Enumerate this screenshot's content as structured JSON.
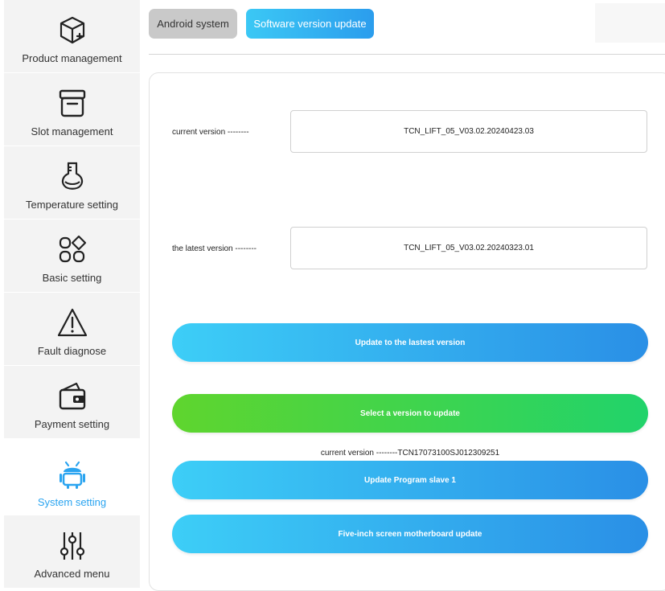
{
  "sidebar": {
    "items": [
      {
        "label": "Product management",
        "icon": "box-plus-icon",
        "active": false
      },
      {
        "label": "Slot management",
        "icon": "archive-box-icon",
        "active": false
      },
      {
        "label": "Temperature setting",
        "icon": "flask-icon",
        "active": false
      },
      {
        "label": "Basic setting",
        "icon": "shapes-grid-icon",
        "active": false
      },
      {
        "label": "Fault diagnose",
        "icon": "warning-triangle-icon",
        "active": false
      },
      {
        "label": "Payment setting",
        "icon": "wallet-icon",
        "active": false
      },
      {
        "label": "System setting",
        "icon": "android-robot-icon",
        "active": true
      },
      {
        "label": "Advanced menu",
        "icon": "sliders-icon",
        "active": false
      }
    ]
  },
  "tabs": {
    "android": "Android system",
    "software": "Software version update"
  },
  "version": {
    "current_label": "current version --------",
    "current_value": "TCN_LIFT_05_V03.02.20240423.03",
    "latest_label": "the latest version --------",
    "latest_value": "TCN_LIFT_05_V03.02.20240323.01"
  },
  "buttons": {
    "update_latest": "Update to the lastest version",
    "select_version": "Select a version to update",
    "slave_caption": "current version --------TCN17073100SJ012309251",
    "update_slave": "Update Program slave 1",
    "five_inch": "Five-inch screen motherboard update"
  },
  "colors": {
    "accent": "#2aa4f0",
    "blue_gradient_start": "#3dcef7",
    "blue_gradient_end": "#2a8fe6",
    "green_gradient_start": "#5fd52e",
    "green_gradient_end": "#21d36b"
  }
}
